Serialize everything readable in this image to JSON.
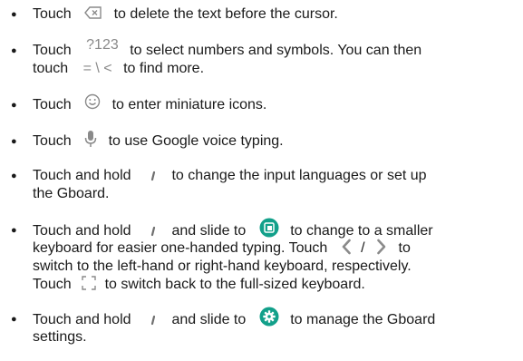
{
  "items": [
    {
      "lines": [
        {
          "pre": "Touch",
          "post": "to delete the text before the cursor."
        }
      ],
      "icon": "backspace-icon"
    },
    {
      "lines": [
        {
          "pre": "Touch",
          "icon_text": "?123",
          "post": "to select numbers and symbols. You can then"
        },
        {
          "pre": "touch",
          "icon_text": "= \\ <",
          "post": "to find more."
        }
      ]
    },
    {
      "lines": [
        {
          "pre": "Touch",
          "post": "to enter miniature icons."
        }
      ],
      "icon": "emoji-icon"
    },
    {
      "lines": [
        {
          "pre": "Touch",
          "post": "to use Google voice typing."
        }
      ],
      "icon": "microphone-icon"
    },
    {
      "lines": [
        {
          "pre": "Touch and hold",
          "post": "to change the input languages or set up"
        },
        {
          "text": "the Gboard."
        }
      ],
      "icon": "comma-key-icon"
    },
    {
      "lines": [
        {
          "pre": "Touch and hold",
          "mid": "and slide to",
          "post": "to change to a smaller"
        },
        {
          "pre": "keyboard for easier one-handed typing. Touch",
          "sep": "/",
          "post": "to"
        },
        {
          "text": "switch to the left-hand or right-hand keyboard, respectively."
        },
        {
          "pre": "Touch",
          "post": "to switch back to the full-sized keyboard."
        }
      ],
      "icons": [
        "comma-key-icon",
        "one-handed-mode-icon",
        "chevron-left-icon",
        "chevron-right-icon",
        "expand-keyboard-icon"
      ]
    },
    {
      "lines": [
        {
          "pre": "Touch and hold",
          "mid": "and slide to",
          "post": "to manage the Gboard"
        },
        {
          "text": "settings."
        }
      ],
      "icons": [
        "comma-key-icon",
        "settings-gear-icon"
      ]
    }
  ],
  "colors": {
    "icon_gray": "#8a8a8a",
    "accent_green": "#12a08a"
  }
}
